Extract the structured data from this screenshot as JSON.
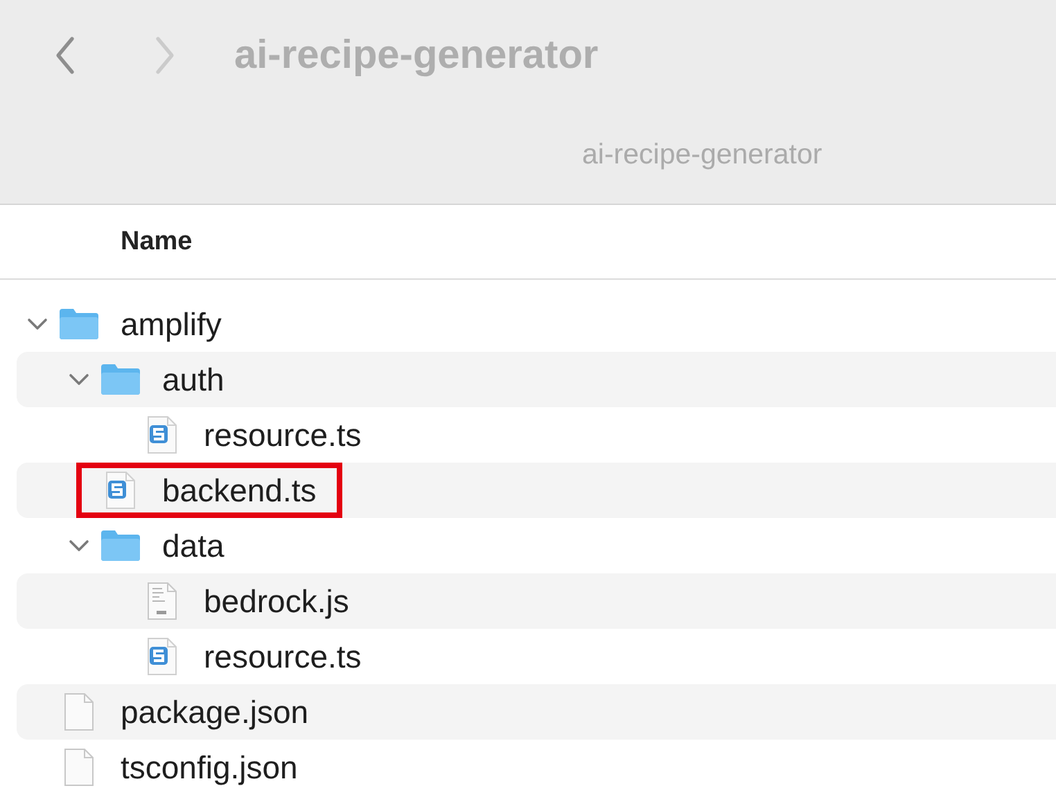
{
  "window": {
    "title": "ai-recipe-generator",
    "back_button": {
      "disabled": false
    },
    "forward_button": {
      "disabled": true
    }
  },
  "path_bar": {
    "label": "ai-recipe-generator"
  },
  "list": {
    "columns": [
      "Name"
    ],
    "items": [
      {
        "name": "amplify",
        "kind": "folder",
        "expanded": true,
        "highlighted": false,
        "children": [
          {
            "name": "auth",
            "kind": "folder",
            "expanded": true,
            "highlighted": false,
            "children": [
              {
                "name": "resource.ts",
                "kind": "ts",
                "highlighted": false
              }
            ]
          },
          {
            "name": "backend.ts",
            "kind": "ts",
            "highlighted": true
          },
          {
            "name": "data",
            "kind": "folder",
            "expanded": true,
            "highlighted": false,
            "children": [
              {
                "name": "bedrock.js",
                "kind": "js",
                "highlighted": false
              },
              {
                "name": "resource.ts",
                "kind": "ts",
                "highlighted": false
              }
            ]
          }
        ]
      },
      {
        "name": "package.json",
        "kind": "file",
        "highlighted": false
      },
      {
        "name": "tsconfig.json",
        "kind": "file",
        "highlighted": false
      }
    ]
  }
}
